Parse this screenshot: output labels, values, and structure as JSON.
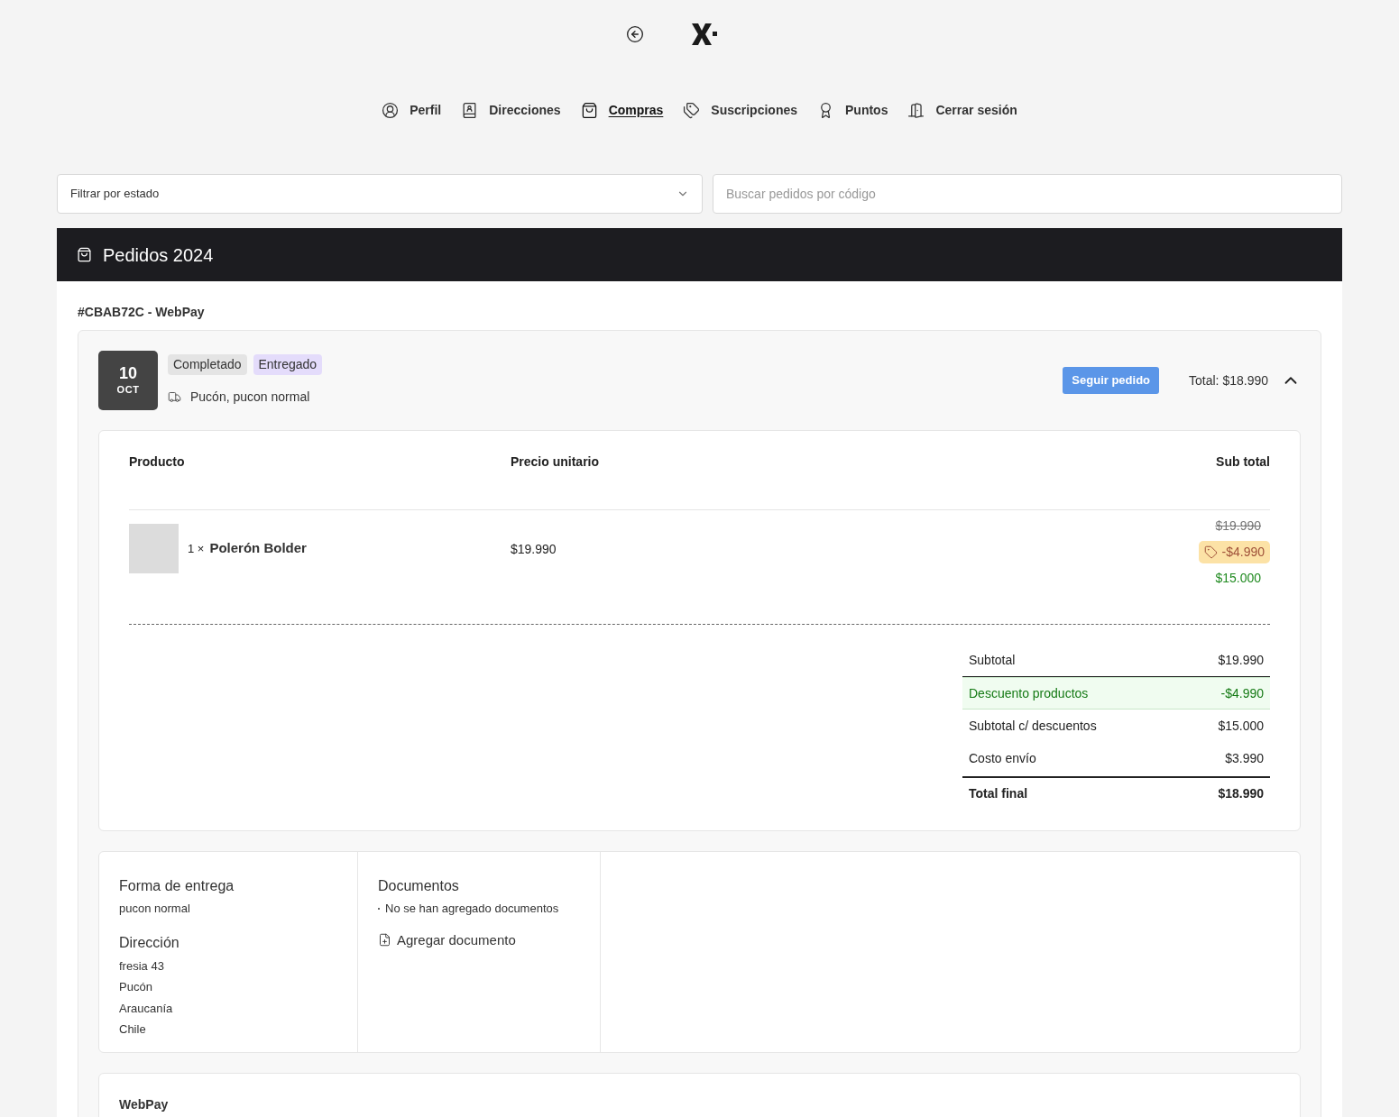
{
  "nav": [
    {
      "label": "Perfil",
      "selected": false
    },
    {
      "label": "Direcciones",
      "selected": false
    },
    {
      "label": "Compras",
      "selected": true
    },
    {
      "label": "Suscripciones",
      "selected": false
    },
    {
      "label": "Puntos",
      "selected": false
    },
    {
      "label": "Cerrar sesión",
      "selected": false
    }
  ],
  "filters": {
    "status_select": "Filtrar por estado",
    "search_placeholder": "Buscar pedidos por código"
  },
  "section_title": "Pedidos 2024",
  "order": {
    "reference": "#CBAB72C - WebPay",
    "day": "10",
    "month": "OCT",
    "badges": [
      {
        "label": "Completado",
        "color": "#e4e4e4"
      },
      {
        "label": "Entregado",
        "color": "#e4dcfb"
      }
    ],
    "shipping": "Pucón, pucon normal",
    "track_button": "Seguir pedido",
    "total": "Total: $18.990",
    "expanded": true,
    "table": {
      "columns": [
        "Producto",
        "Precio unitario",
        "Sub total"
      ],
      "rows": [
        {
          "quantity": "1 ×",
          "name": "Polerón Bolder",
          "unit_price": "$19.990",
          "original": "$19.990",
          "discount": "-$4.990",
          "final": "$15.000"
        }
      ]
    },
    "summary": [
      {
        "label": "Subtotal",
        "value": "$19.990",
        "kind": "normal"
      },
      {
        "label": "Descuento productos",
        "value": "-$4.990",
        "kind": "discount"
      },
      {
        "label": "Subtotal c/ descuentos",
        "value": "$15.000",
        "kind": "normal"
      },
      {
        "label": "Costo envío",
        "value": "$3.990",
        "kind": "normal"
      },
      {
        "label": "Total final",
        "value": "$18.990",
        "kind": "total"
      }
    ],
    "delivery": {
      "title": "Forma de entrega",
      "value": "pucon normal"
    },
    "address": {
      "title": "Dirección",
      "lines": [
        "fresia 43",
        "Pucón",
        "Araucanía",
        "Chile"
      ]
    },
    "documents": {
      "title": "Documentos",
      "empty": "No se han agregado documentos",
      "add": "Agregar documento"
    },
    "payment": {
      "title": "WebPay"
    }
  }
}
